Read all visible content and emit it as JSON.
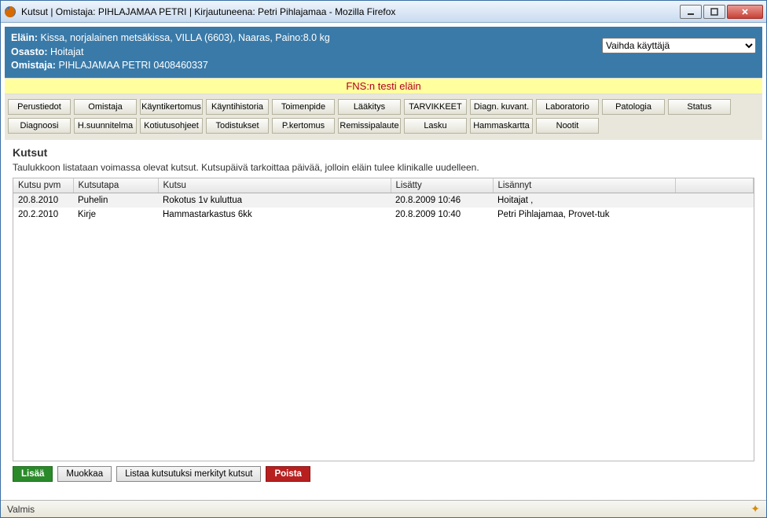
{
  "window": {
    "title": "Kutsut | Omistaja: PIHLAJAMAA PETRI | Kirjautuneena: Petri Pihlajamaa - Mozilla Firefox"
  },
  "header": {
    "animal_label": "Eläin:",
    "animal_value": "Kissa, norjalainen metsäkissa, VILLA (6603), Naaras, Paino:8.0 kg",
    "dept_label": "Osasto:",
    "dept_value": "Hoitajat",
    "owner_label": "Omistaja:",
    "owner_value": "PIHLAJAMAA PETRI 0408460337",
    "switch_user": "Vaihda käyttäjä"
  },
  "banner": "FNS:n testi eläin",
  "nav": {
    "row1": [
      "Perustiedot",
      "Omistaja",
      "Käyntikertomus",
      "Käyntihistoria",
      "Toimenpide",
      "Lääkitys",
      "TARVIKKEET",
      "Diagn. kuvant.",
      "Laboratorio",
      "Patologia",
      "Status"
    ],
    "row2": [
      "Diagnoosi",
      "H.suunnitelma",
      "Kotiutusohjeet",
      "Todistukset",
      "P.kertomus",
      "Remissipalaute",
      "Lasku",
      "Hammaskartta",
      "Nootit"
    ]
  },
  "page": {
    "title": "Kutsut",
    "desc": "Taulukkoon listataan voimassa olevat kutsut. Kutsupäivä tarkoittaa päivää, jolloin eläin tulee klinikalle uudelleen."
  },
  "table": {
    "headers": [
      "Kutsu pvm",
      "Kutsutapa",
      "Kutsu",
      "Lisätty",
      "Lisännyt",
      ""
    ],
    "rows": [
      {
        "pvm": "20.8.2010",
        "tapa": "Puhelin",
        "kutsu": "Rokotus 1v kuluttua",
        "lisatty": "20.8.2009 10:46",
        "lisannyt": "Hoitajat ,"
      },
      {
        "pvm": "20.2.2010",
        "tapa": "Kirje",
        "kutsu": "Hammastarkastus 6kk",
        "lisatty": "20.8.2009 10:40",
        "lisannyt": "Petri Pihlajamaa, Provet-tuk"
      }
    ]
  },
  "actions": {
    "add": "Lisää",
    "edit": "Muokkaa",
    "list": "Listaa kutsutuksi merkityt kutsut",
    "delete": "Poista"
  },
  "statusbar": {
    "text": "Valmis"
  }
}
